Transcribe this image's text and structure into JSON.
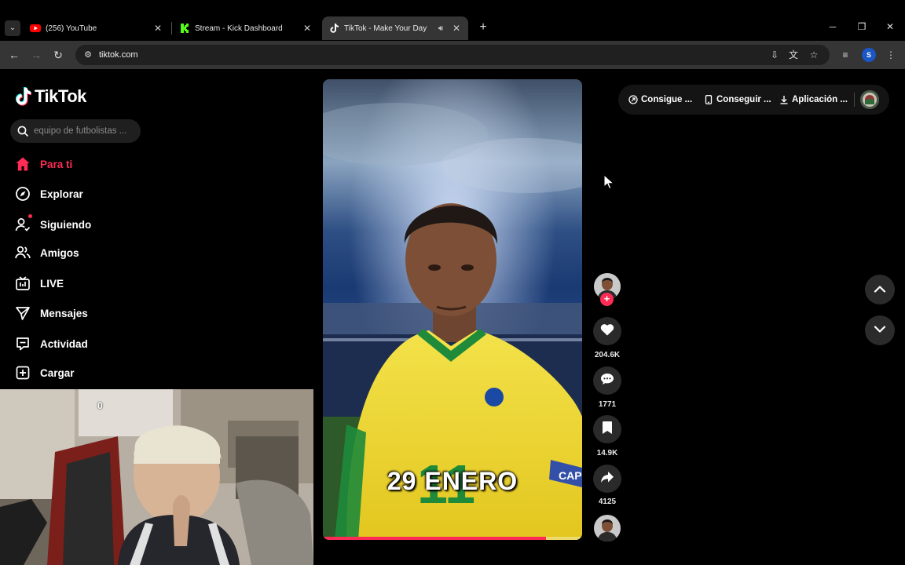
{
  "browser": {
    "tabs": [
      {
        "title": "(256) YouTube",
        "favicon": "youtube-icon",
        "active": false
      },
      {
        "title": "Stream - Kick Dashboard",
        "favicon": "kick-icon",
        "active": false
      },
      {
        "title": "TikTok - Make Your Day",
        "favicon": "tiktok-icon",
        "active": true,
        "audio": true
      }
    ],
    "address": "tiktok.com",
    "profile_initial": "S"
  },
  "sidebar": {
    "logo_text": "TikTok",
    "search": {
      "placeholder": "equipo de futbolistas ..."
    },
    "items": [
      {
        "label": "Para ti",
        "icon": "home-icon",
        "active": true
      },
      {
        "label": "Explorar",
        "icon": "compass-icon"
      },
      {
        "label": "Siguiendo",
        "icon": "following-icon",
        "badge": true
      },
      {
        "label": "Amigos",
        "icon": "friends-icon"
      },
      {
        "label": "LIVE",
        "icon": "live-icon"
      },
      {
        "label": "Mensajes",
        "icon": "messages-icon"
      },
      {
        "label": "Actividad",
        "icon": "activity-icon"
      },
      {
        "label": "Cargar",
        "icon": "upload-icon"
      }
    ]
  },
  "webcam": {
    "overlay_text": "0"
  },
  "video": {
    "caption": "29 ENERO",
    "jersey_number": "11",
    "armband_text": "CAP",
    "progress": 0.86
  },
  "actions": {
    "likes": "204.6K",
    "comments": "1771",
    "saves": "14.9K",
    "shares": "4125"
  },
  "topbar": {
    "items": [
      {
        "label": "Consigue ...",
        "icon": "coin-icon"
      },
      {
        "label": "Conseguir ...",
        "icon": "phone-icon"
      },
      {
        "label": "Aplicación ...",
        "icon": "download-icon"
      }
    ]
  },
  "colors": {
    "accent": "#fe2c55",
    "background": "#000000",
    "chrome": "#353535"
  }
}
